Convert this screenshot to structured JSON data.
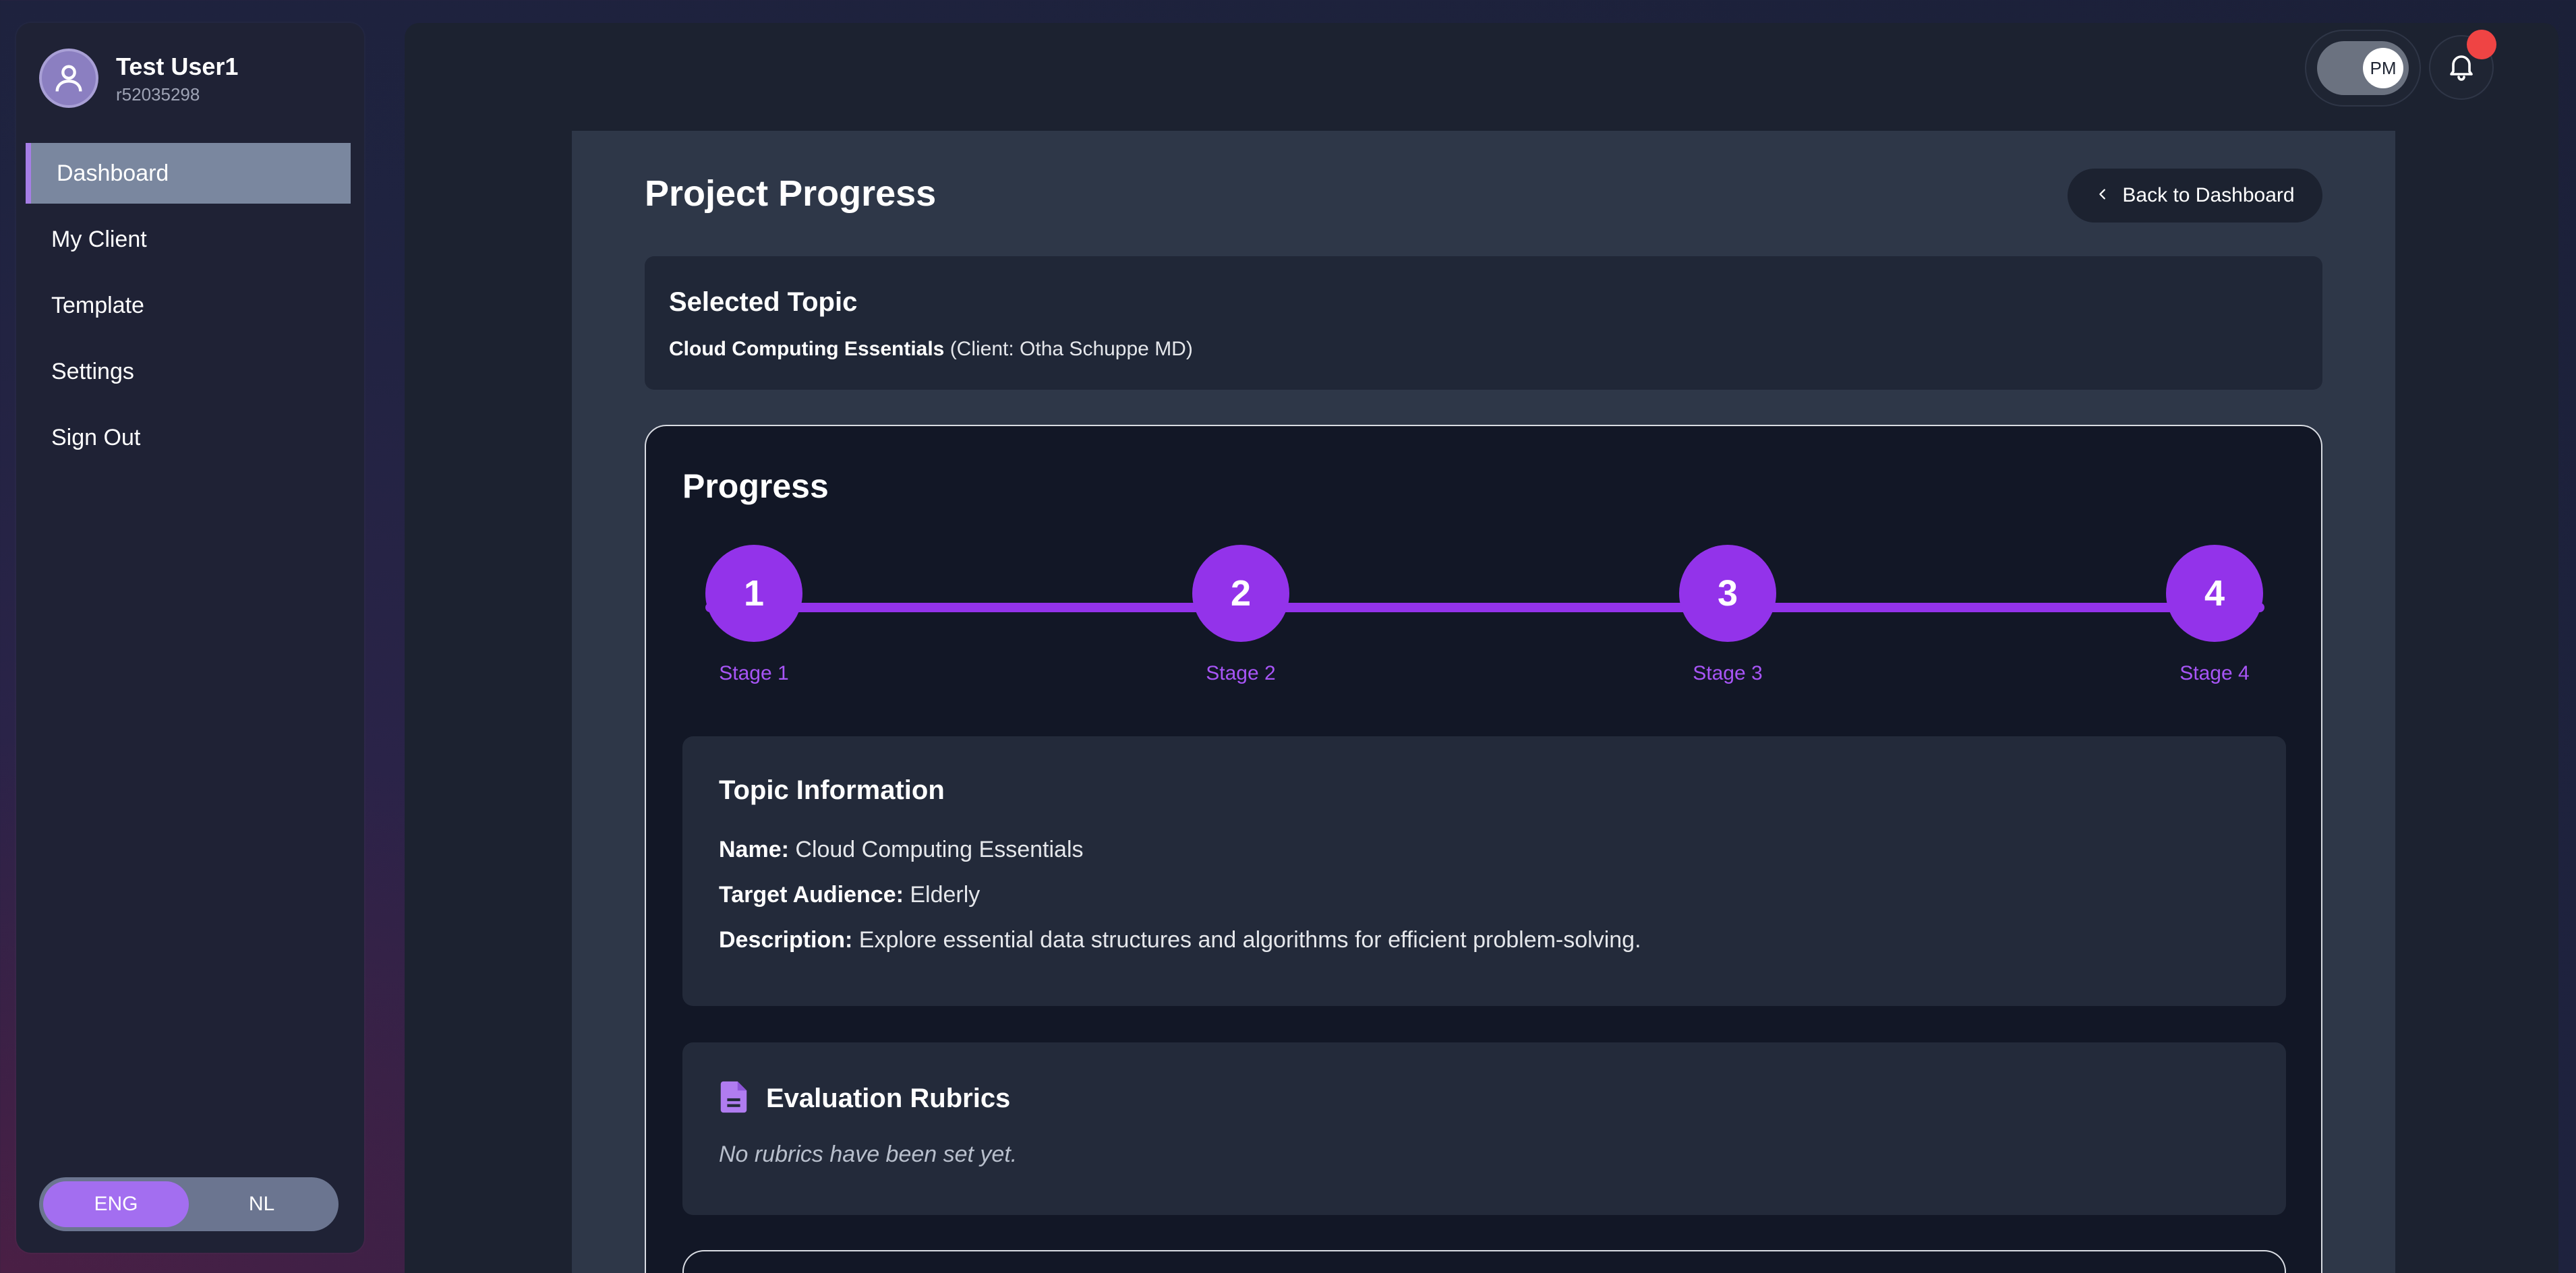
{
  "user": {
    "name": "Test User1",
    "id": "r52035298"
  },
  "sidebar": {
    "items": [
      {
        "label": "Dashboard",
        "active": true
      },
      {
        "label": "My Client"
      },
      {
        "label": "Template"
      },
      {
        "label": "Settings"
      },
      {
        "label": "Sign Out"
      }
    ]
  },
  "language": {
    "options": [
      "ENG",
      "NL"
    ],
    "selected": "ENG"
  },
  "topbar": {
    "role_toggle_label": "PM",
    "notification_dot": true
  },
  "page": {
    "title": "Project Progress",
    "back_label": "Back to Dashboard"
  },
  "selected_topic": {
    "heading": "Selected Topic",
    "topic_name": "Cloud Computing Essentials",
    "client_text": " (Client: Otha Schuppe MD)"
  },
  "progress": {
    "heading": "Progress",
    "steps": [
      {
        "number": "1",
        "label": "Stage 1"
      },
      {
        "number": "2",
        "label": "Stage 2"
      },
      {
        "number": "3",
        "label": "Stage 3"
      },
      {
        "number": "4",
        "label": "Stage 4"
      }
    ]
  },
  "topic_info": {
    "heading": "Topic Information",
    "name_label": "Name:",
    "name_value": " Cloud Computing Essentials",
    "audience_label": "Target Audience:",
    "audience_value": " Elderly",
    "description_label": "Description:",
    "description_value": " Explore essential data structures and algorithms for efficient problem-solving."
  },
  "rubrics": {
    "heading": "Evaluation Rubrics",
    "empty_text": "No rubrics have been set yet."
  },
  "colors": {
    "accent": "#9333ea",
    "accent_text": "#a855f7",
    "notification": "#ef4444"
  }
}
